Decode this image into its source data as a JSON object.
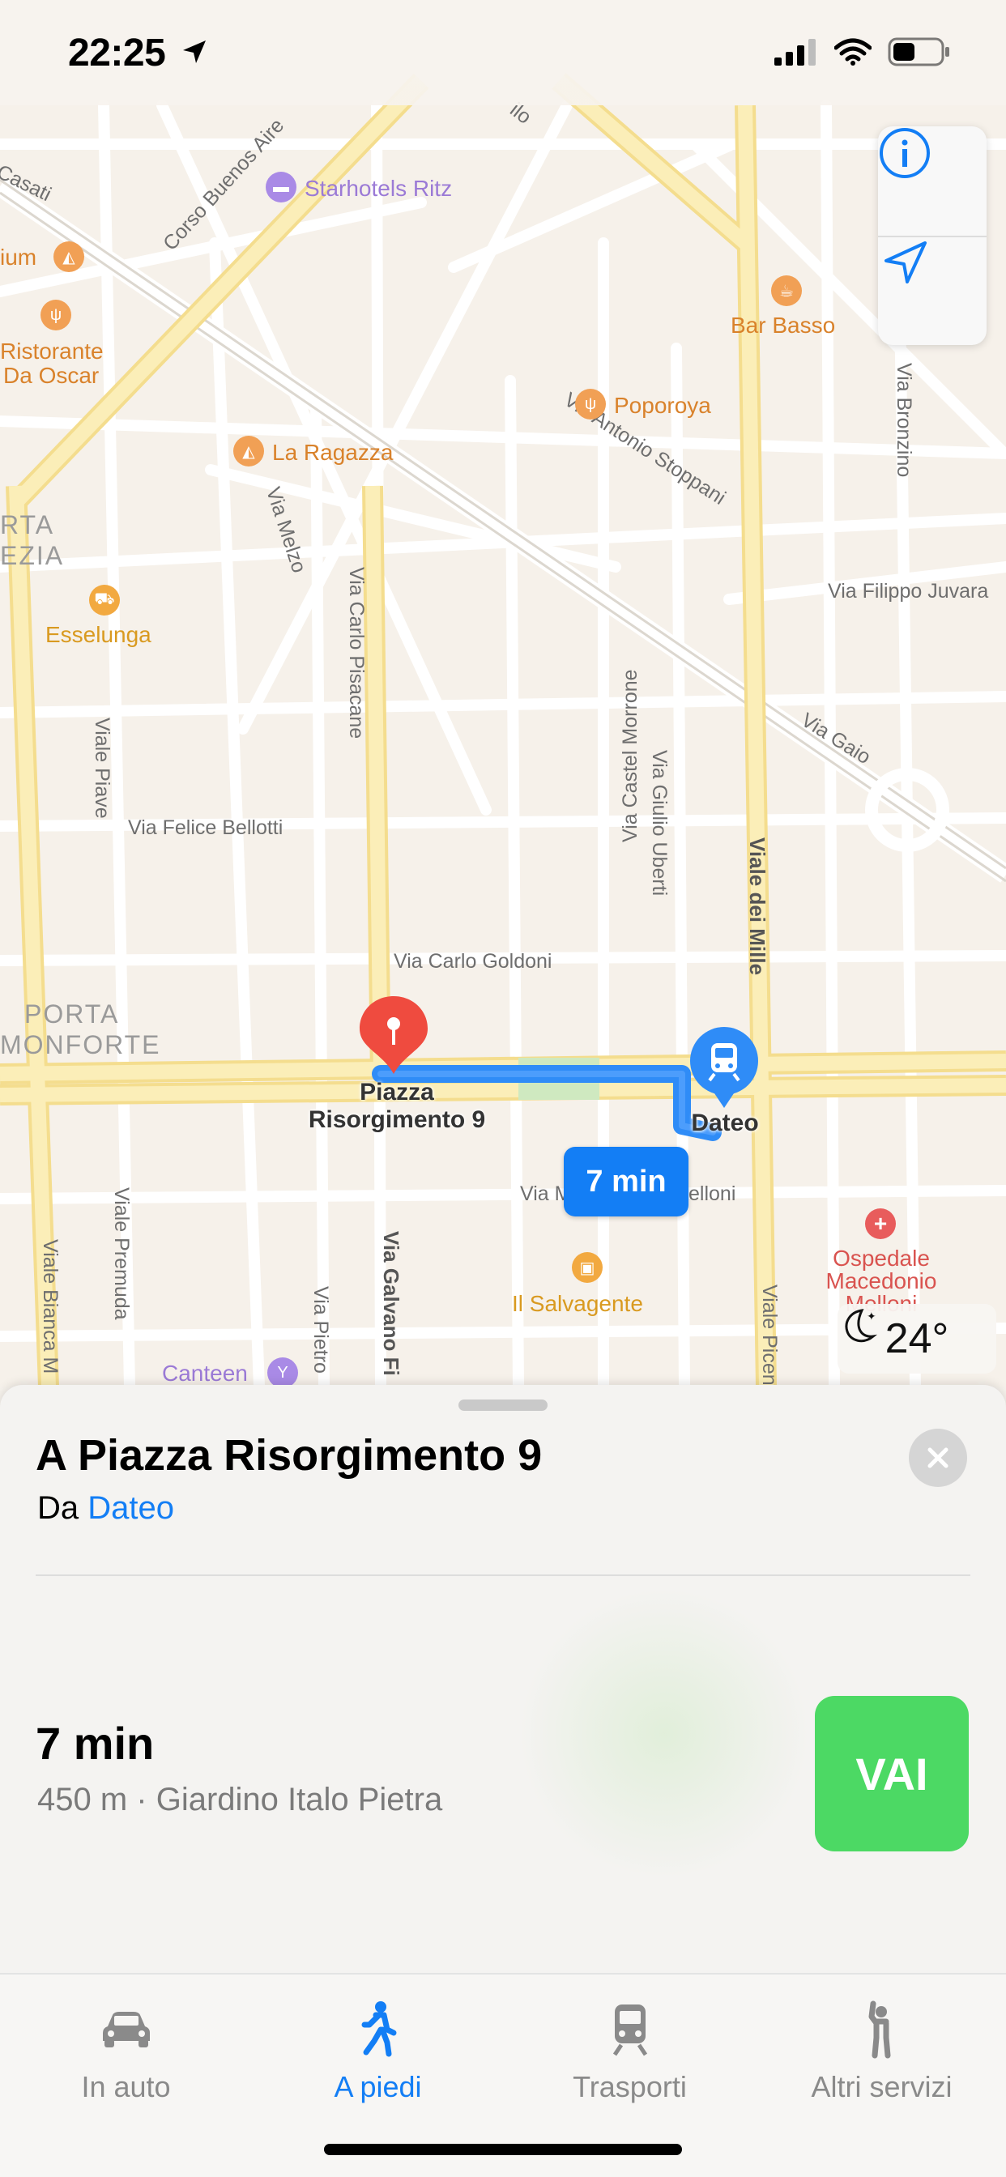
{
  "status_bar": {
    "time": "22:25"
  },
  "map": {
    "streets": {
      "corso_buenos_aires": "Corso Buenos Aire",
      "casati": "Casati",
      "via_antonio_stoppani": "Via Antonio Stoppani",
      "via_melzo": "Via Melzo",
      "via_carlo_pisacane": "Via Carlo Pisacane",
      "viale_piave": "Viale Piave",
      "via_felice_bellotti": "Via Felice Bellotti",
      "via_carlo_goldoni": "Via Carlo Goldoni",
      "via_castel_morrone": "Via Castel Morrone",
      "via_giulio_uberti": "Via Giulio Uberti",
      "viale_dei_mille": "Viale dei Mille",
      "via_bronzino": "Via Bronzino",
      "via_filippo_juvara": "Via Filippo Juvara",
      "via_gaio": "Via Gaio",
      "viale_premuda": "Viale Premuda",
      "viale_bianca_maria": "Viale Bianca M",
      "via_pietro": "Via Pietro",
      "via_galvano_fiamma": "Via Galvano Fi",
      "via_mellon_left": "Via M",
      "via_mellon_right": "elloni",
      "viale_piceno": "Viale Picen",
      "top_partial": "ilo"
    },
    "districts": {
      "porta_venezia_1": "RTA",
      "porta_venezia_2": "EZIA",
      "porta_monforte_1": "PORTA",
      "porta_monforte_2": "MONFORTE"
    },
    "pois": {
      "starhotels": "Starhotels Ritz",
      "ium": "ium",
      "ristorante_1": "Ristorante",
      "ristorante_2": "Da Oscar",
      "la_ragazza": "La Ragazza",
      "poporoya": "Poporoya",
      "bar_basso": "Bar Basso",
      "esselunga": "Esselunga",
      "il_salvagente": "Il Salvagente",
      "canteen": "Canteen",
      "ospedale_1": "Ospedale",
      "ospedale_2": "Macedonio",
      "ospedale_3": "Melloni"
    },
    "destination_pin": {
      "line1": "Piazza",
      "line2": "Risorgimento 9"
    },
    "origin_pin": {
      "label": "Dateo"
    },
    "route_time_bubble": "7 min",
    "weather": {
      "icon": "moon-icon",
      "temperature": "24°"
    }
  },
  "sheet": {
    "title": "A Piazza Risorgimento 9",
    "from_prefix": "Da",
    "from_link": "Dateo",
    "route_time": "7 min",
    "route_details": "450 m · Giardino Italo Pietra",
    "go_label": "VAI"
  },
  "tabs": [
    {
      "label": "In auto",
      "icon": "car-icon",
      "active": false
    },
    {
      "label": "A piedi",
      "icon": "walking-icon",
      "active": true
    },
    {
      "label": "Trasporti",
      "icon": "train-icon",
      "active": false
    },
    {
      "label": "Altri servizi",
      "icon": "hail-icon",
      "active": false
    }
  ],
  "colors": {
    "accent": "#137ef5",
    "route": "#2f8cf7",
    "go_button": "#4cd964",
    "destination_pin": "#ef4b3f",
    "primary_road": "#fbe9a6"
  }
}
